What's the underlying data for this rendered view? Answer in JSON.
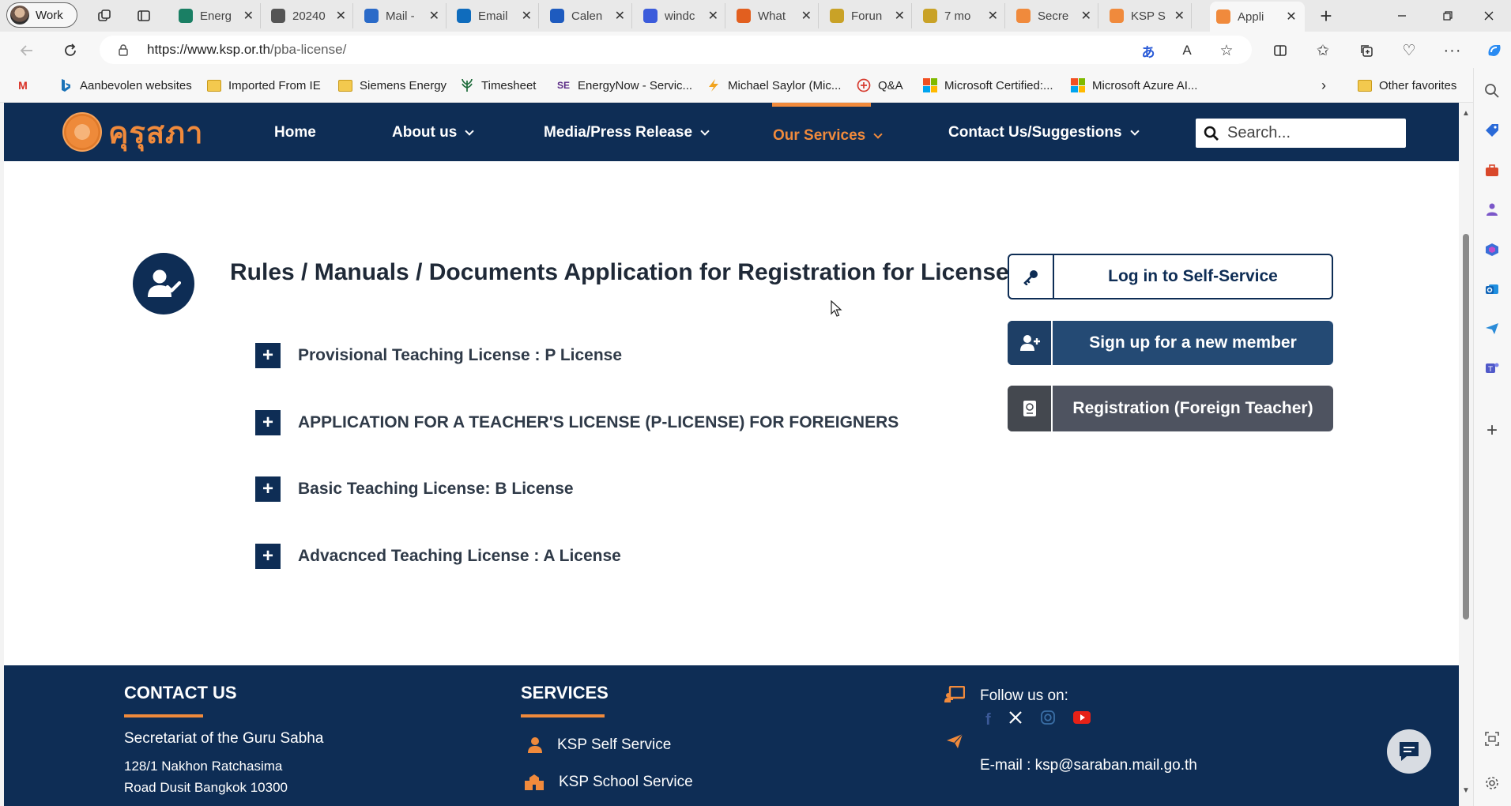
{
  "browser": {
    "profile_label": "Work",
    "tabs": [
      {
        "title": "Energ",
        "favicon_color": "#1a7f64"
      },
      {
        "title": "20240",
        "favicon_color": "#555555"
      },
      {
        "title": "Mail -",
        "favicon_color": "#2a6ac8"
      },
      {
        "title": "Email",
        "favicon_color": "#0f6cbd"
      },
      {
        "title": "Calen",
        "favicon_color": "#1e5bbf"
      },
      {
        "title": "windc",
        "favicon_color": "#3b5bdb"
      },
      {
        "title": "What",
        "favicon_color": "#e25f1f"
      },
      {
        "title": "Forun",
        "favicon_color": "#c9a227"
      },
      {
        "title": "7 mo",
        "favicon_color": "#c9a227"
      },
      {
        "title": "Secre",
        "favicon_color": "#f08a3c"
      },
      {
        "title": "KSP S",
        "favicon_color": "#f08a3c"
      },
      {
        "title": "Appli",
        "favicon_color": "#f08a3c"
      }
    ],
    "new_tab_symbol": "+",
    "close_symbol": "✕",
    "url_domain": "https://www.ksp.or.th",
    "url_path": "/pba-license/",
    "bookmarks": [
      {
        "label": "Aanbevolen websites",
        "icon": "bing-icon"
      },
      {
        "label": "Imported From IE",
        "icon": "folder-icon"
      },
      {
        "label": "Siemens Energy",
        "icon": "folder-icon"
      },
      {
        "label": "Timesheet",
        "icon": "leaf-icon"
      },
      {
        "label": "EnergyNow - Servic...",
        "icon": "se-icon"
      },
      {
        "label": "Michael Saylor (Mic...",
        "icon": "bolt-icon"
      },
      {
        "label": "Q&A",
        "icon": "qa-icon"
      },
      {
        "label": "Microsoft Certified:...",
        "icon": "microsoft-icon"
      },
      {
        "label": "Microsoft Azure AI...",
        "icon": "microsoft-icon"
      }
    ],
    "other_favorites": "Other favorites"
  },
  "site": {
    "logo_text": "คุรุสภา",
    "nav": {
      "home": "Home",
      "about": "About us",
      "media": "Media/Press Release",
      "services": "Our Services",
      "contact": "Contact Us/Suggestions"
    },
    "search_placeholder": "Search...",
    "page_title": "Rules / Manuals / Documents Application for Registration for License",
    "accordion": [
      "Provisional Teaching License : P License",
      "APPLICATION FOR A TEACHER'S LICENSE (P-LICENSE) FOR FOREIGNERS",
      "Basic Teaching License: B License",
      "Advacnced Teaching License : A License"
    ],
    "buttons": {
      "login": "Log in to Self-Service",
      "signup": "Sign up for a new member",
      "foreign": "Registration (Foreign Teacher)"
    },
    "footer": {
      "contact_heading": "CONTACT US",
      "org_name": "Secretariat of the Guru Sabha",
      "address_line1": "128/1 Nakhon Ratchasima",
      "address_line2": "Road Dusit Bangkok 10300",
      "services_heading": "SERVICES",
      "service_1": "KSP Self Service",
      "service_2": "KSP School Service",
      "follow_label": "Follow us on:",
      "email": "E-mail : ksp@saraban.mail.go.th"
    },
    "colors": {
      "navy": "#0e2d55",
      "orange": "#f08a3c"
    }
  }
}
